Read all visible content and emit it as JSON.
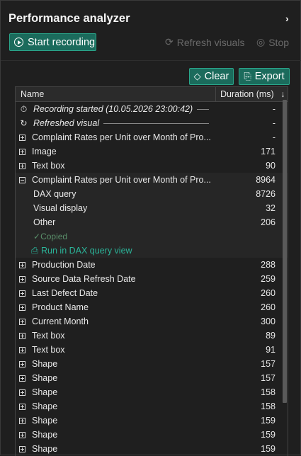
{
  "pane": {
    "title": "Performance analyzer",
    "collapse_icon": "›"
  },
  "toolbar": {
    "start_label": "Start recording",
    "refresh_label": "Refresh visuals",
    "stop_label": "Stop"
  },
  "actions": {
    "clear_label": "Clear",
    "export_label": "Export"
  },
  "table": {
    "col_name": "Name",
    "col_duration": "Duration (ms)",
    "sort_icon": "↓",
    "rows": [
      {
        "type": "timer",
        "name": "Recording started (10.05.2026 23:00:42)",
        "dur": "-"
      },
      {
        "type": "refresh",
        "name": "Refreshed visual",
        "dur": "-"
      },
      {
        "type": "plus",
        "name": "Complaint Rates per Unit over Month of Pro...",
        "dur": "-"
      },
      {
        "type": "plus",
        "name": "Image",
        "dur": "171"
      },
      {
        "type": "plus",
        "name": "Text box",
        "dur": "90"
      },
      {
        "type": "minus",
        "name": "Complaint Rates per Unit over Month of Pro...",
        "dur": "8964"
      },
      {
        "type": "child",
        "name": "DAX query",
        "dur": "8726"
      },
      {
        "type": "child",
        "name": "Visual display",
        "dur": "32"
      },
      {
        "type": "child",
        "name": "Other",
        "dur": "206"
      },
      {
        "type": "copied",
        "name": "Copied",
        "dur": ""
      },
      {
        "type": "runq",
        "name": "Run in DAX query view",
        "dur": ""
      },
      {
        "type": "plus",
        "name": "Production Date",
        "dur": "288"
      },
      {
        "type": "plus",
        "name": "Source Data Refresh Date",
        "dur": "259"
      },
      {
        "type": "plus",
        "name": "Last Defect Date",
        "dur": "260"
      },
      {
        "type": "plus",
        "name": "Product Name",
        "dur": "260"
      },
      {
        "type": "plus",
        "name": "Current Month",
        "dur": "300"
      },
      {
        "type": "plus",
        "name": "Text box",
        "dur": "89"
      },
      {
        "type": "plus",
        "name": "Text box",
        "dur": "91"
      },
      {
        "type": "plus",
        "name": "Shape",
        "dur": "157"
      },
      {
        "type": "plus",
        "name": "Shape",
        "dur": "157"
      },
      {
        "type": "plus",
        "name": "Shape",
        "dur": "158"
      },
      {
        "type": "plus",
        "name": "Shape",
        "dur": "158"
      },
      {
        "type": "plus",
        "name": "Shape",
        "dur": "159"
      },
      {
        "type": "plus",
        "name": "Shape",
        "dur": "159"
      },
      {
        "type": "plus",
        "name": "Shape",
        "dur": "159"
      }
    ]
  }
}
